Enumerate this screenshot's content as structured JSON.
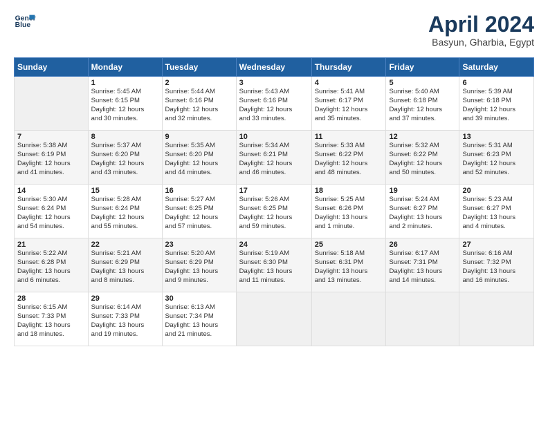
{
  "header": {
    "logo_line1": "General",
    "logo_line2": "Blue",
    "main_title": "April 2024",
    "subtitle": "Basyun, Gharbia, Egypt"
  },
  "weekdays": [
    "Sunday",
    "Monday",
    "Tuesday",
    "Wednesday",
    "Thursday",
    "Friday",
    "Saturday"
  ],
  "weeks": [
    [
      {
        "day": "",
        "info": ""
      },
      {
        "day": "1",
        "info": "Sunrise: 5:45 AM\nSunset: 6:15 PM\nDaylight: 12 hours\nand 30 minutes."
      },
      {
        "day": "2",
        "info": "Sunrise: 5:44 AM\nSunset: 6:16 PM\nDaylight: 12 hours\nand 32 minutes."
      },
      {
        "day": "3",
        "info": "Sunrise: 5:43 AM\nSunset: 6:16 PM\nDaylight: 12 hours\nand 33 minutes."
      },
      {
        "day": "4",
        "info": "Sunrise: 5:41 AM\nSunset: 6:17 PM\nDaylight: 12 hours\nand 35 minutes."
      },
      {
        "day": "5",
        "info": "Sunrise: 5:40 AM\nSunset: 6:18 PM\nDaylight: 12 hours\nand 37 minutes."
      },
      {
        "day": "6",
        "info": "Sunrise: 5:39 AM\nSunset: 6:18 PM\nDaylight: 12 hours\nand 39 minutes."
      }
    ],
    [
      {
        "day": "7",
        "info": "Sunrise: 5:38 AM\nSunset: 6:19 PM\nDaylight: 12 hours\nand 41 minutes."
      },
      {
        "day": "8",
        "info": "Sunrise: 5:37 AM\nSunset: 6:20 PM\nDaylight: 12 hours\nand 43 minutes."
      },
      {
        "day": "9",
        "info": "Sunrise: 5:35 AM\nSunset: 6:20 PM\nDaylight: 12 hours\nand 44 minutes."
      },
      {
        "day": "10",
        "info": "Sunrise: 5:34 AM\nSunset: 6:21 PM\nDaylight: 12 hours\nand 46 minutes."
      },
      {
        "day": "11",
        "info": "Sunrise: 5:33 AM\nSunset: 6:22 PM\nDaylight: 12 hours\nand 48 minutes."
      },
      {
        "day": "12",
        "info": "Sunrise: 5:32 AM\nSunset: 6:22 PM\nDaylight: 12 hours\nand 50 minutes."
      },
      {
        "day": "13",
        "info": "Sunrise: 5:31 AM\nSunset: 6:23 PM\nDaylight: 12 hours\nand 52 minutes."
      }
    ],
    [
      {
        "day": "14",
        "info": "Sunrise: 5:30 AM\nSunset: 6:24 PM\nDaylight: 12 hours\nand 54 minutes."
      },
      {
        "day": "15",
        "info": "Sunrise: 5:28 AM\nSunset: 6:24 PM\nDaylight: 12 hours\nand 55 minutes."
      },
      {
        "day": "16",
        "info": "Sunrise: 5:27 AM\nSunset: 6:25 PM\nDaylight: 12 hours\nand 57 minutes."
      },
      {
        "day": "17",
        "info": "Sunrise: 5:26 AM\nSunset: 6:25 PM\nDaylight: 12 hours\nand 59 minutes."
      },
      {
        "day": "18",
        "info": "Sunrise: 5:25 AM\nSunset: 6:26 PM\nDaylight: 13 hours\nand 1 minute."
      },
      {
        "day": "19",
        "info": "Sunrise: 5:24 AM\nSunset: 6:27 PM\nDaylight: 13 hours\nand 2 minutes."
      },
      {
        "day": "20",
        "info": "Sunrise: 5:23 AM\nSunset: 6:27 PM\nDaylight: 13 hours\nand 4 minutes."
      }
    ],
    [
      {
        "day": "21",
        "info": "Sunrise: 5:22 AM\nSunset: 6:28 PM\nDaylight: 13 hours\nand 6 minutes."
      },
      {
        "day": "22",
        "info": "Sunrise: 5:21 AM\nSunset: 6:29 PM\nDaylight: 13 hours\nand 8 minutes."
      },
      {
        "day": "23",
        "info": "Sunrise: 5:20 AM\nSunset: 6:29 PM\nDaylight: 13 hours\nand 9 minutes."
      },
      {
        "day": "24",
        "info": "Sunrise: 5:19 AM\nSunset: 6:30 PM\nDaylight: 13 hours\nand 11 minutes."
      },
      {
        "day": "25",
        "info": "Sunrise: 5:18 AM\nSunset: 6:31 PM\nDaylight: 13 hours\nand 13 minutes."
      },
      {
        "day": "26",
        "info": "Sunrise: 6:17 AM\nSunset: 7:31 PM\nDaylight: 13 hours\nand 14 minutes."
      },
      {
        "day": "27",
        "info": "Sunrise: 6:16 AM\nSunset: 7:32 PM\nDaylight: 13 hours\nand 16 minutes."
      }
    ],
    [
      {
        "day": "28",
        "info": "Sunrise: 6:15 AM\nSunset: 7:33 PM\nDaylight: 13 hours\nand 18 minutes."
      },
      {
        "day": "29",
        "info": "Sunrise: 6:14 AM\nSunset: 7:33 PM\nDaylight: 13 hours\nand 19 minutes."
      },
      {
        "day": "30",
        "info": "Sunrise: 6:13 AM\nSunset: 7:34 PM\nDaylight: 13 hours\nand 21 minutes."
      },
      {
        "day": "",
        "info": ""
      },
      {
        "day": "",
        "info": ""
      },
      {
        "day": "",
        "info": ""
      },
      {
        "day": "",
        "info": ""
      }
    ]
  ]
}
